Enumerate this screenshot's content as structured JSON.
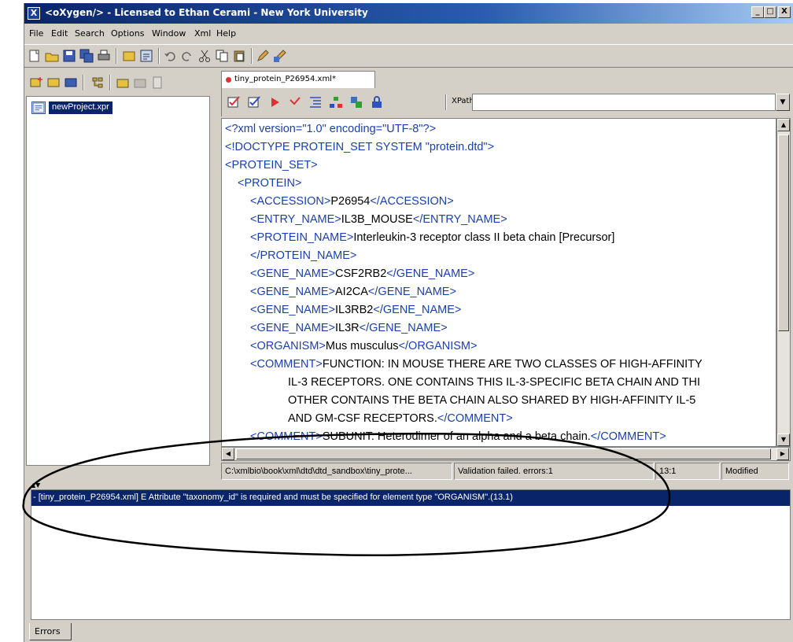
{
  "window": {
    "title": "<oXygen/> - Licensed to Ethan Cerami - New York University",
    "app_icon_glyph": "X",
    "controls": {
      "minimize": "_",
      "maximize": "□",
      "close": "X"
    }
  },
  "menu": [
    "File",
    "Edit",
    "Search",
    "Options",
    "Window",
    "Xml",
    "Help"
  ],
  "main_toolbar_icons": [
    "new-file-icon",
    "open-file-icon",
    "save-icon",
    "save-all-icon",
    "print-icon",
    "open-project-icon",
    "properties-icon",
    "undo-icon",
    "redo-icon",
    "cut-icon",
    "copy-icon",
    "paste-icon",
    "pencil-icon",
    "transform-icon"
  ],
  "project_toolbar_icons": [
    "new-project-icon",
    "open-project-icon",
    "save-project-icon",
    "tree-icon",
    "add-folder-icon",
    "add-files-icon",
    "add-file-icon"
  ],
  "project": {
    "item_label": "newProject.xpr"
  },
  "editor": {
    "tab_label": "tiny_protein_P26954.xml*",
    "toolbar_icons": [
      "validate-icon",
      "check-well-formed-icon",
      "run-icon",
      "transform-icon",
      "format-indent-icon",
      "tree-view-icon",
      "schema-icon",
      "lock-icon"
    ],
    "xpath_label": "XPath:",
    "xpath_value": "",
    "lines": [
      {
        "indent": 0,
        "parts": [
          [
            "tag",
            "<?xml version=\"1.0\" encoding=\"UTF-8\"?>"
          ]
        ]
      },
      {
        "indent": 0,
        "parts": [
          [
            "tag",
            "<!DOCTYPE PROTEIN_SET SYSTEM \"protein.dtd\">"
          ]
        ]
      },
      {
        "indent": 0,
        "parts": [
          [
            "tag",
            "<PROTEIN_SET>"
          ]
        ]
      },
      {
        "indent": 1,
        "parts": [
          [
            "tag",
            "<PROTEIN>"
          ]
        ]
      },
      {
        "indent": 2,
        "parts": [
          [
            "tag",
            "<ACCESSION>"
          ],
          [
            "txt",
            "P26954"
          ],
          [
            "tag",
            "</ACCESSION>"
          ]
        ]
      },
      {
        "indent": 2,
        "parts": [
          [
            "tag",
            "<ENTRY_NAME>"
          ],
          [
            "txt",
            "IL3B_MOUSE"
          ],
          [
            "tag",
            "</ENTRY_NAME>"
          ]
        ]
      },
      {
        "indent": 2,
        "parts": [
          [
            "tag",
            "<PROTEIN_NAME>"
          ],
          [
            "txt",
            "Interleukin-3 receptor class II beta chain [Precursor]"
          ]
        ]
      },
      {
        "indent": 2,
        "parts": [
          [
            "tag",
            "</PROTEIN_NAME>"
          ]
        ]
      },
      {
        "indent": 2,
        "parts": [
          [
            "tag",
            "<GENE_NAME>"
          ],
          [
            "txt",
            "CSF2RB2"
          ],
          [
            "tag",
            "</GENE_NAME>"
          ]
        ]
      },
      {
        "indent": 2,
        "parts": [
          [
            "tag",
            "<GENE_NAME>"
          ],
          [
            "txt",
            "AI2CA"
          ],
          [
            "tag",
            "</GENE_NAME>"
          ]
        ]
      },
      {
        "indent": 2,
        "parts": [
          [
            "tag",
            "<GENE_NAME>"
          ],
          [
            "txt",
            "IL3RB2"
          ],
          [
            "tag",
            "</GENE_NAME>"
          ]
        ]
      },
      {
        "indent": 2,
        "parts": [
          [
            "tag",
            "<GENE_NAME>"
          ],
          [
            "txt",
            "IL3R"
          ],
          [
            "tag",
            "</GENE_NAME>"
          ]
        ]
      },
      {
        "indent": 2,
        "parts": [
          [
            "tag",
            "<ORGANISM>"
          ],
          [
            "txt",
            "Mus musculus"
          ],
          [
            "tag",
            "</ORGANISM>"
          ]
        ]
      },
      {
        "indent": 2,
        "parts": [
          [
            "tag",
            "<COMMENT>"
          ],
          [
            "txt",
            "FUNCTION: IN MOUSE THERE ARE TWO CLASSES OF HIGH-AFFINITY"
          ]
        ]
      },
      {
        "indent": 5,
        "parts": [
          [
            "txt",
            "IL-3 RECEPTORS. ONE CONTAINS THIS IL-3-SPECIFIC BETA CHAIN AND THI"
          ]
        ]
      },
      {
        "indent": 5,
        "parts": [
          [
            "txt",
            "OTHER CONTAINS THE BETA CHAIN ALSO SHARED BY HIGH-AFFINITY IL-5"
          ]
        ]
      },
      {
        "indent": 5,
        "parts": [
          [
            "txt",
            "AND GM-CSF RECEPTORS."
          ],
          [
            "tag",
            "</COMMENT>"
          ]
        ]
      },
      {
        "indent": 2,
        "parts": [
          [
            "tag",
            "<COMMENT>"
          ],
          [
            "txt",
            "SUBUNIT: Heterodimer of an alpha and a beta chain."
          ],
          [
            "tag",
            "</COMMENT>"
          ]
        ]
      }
    ]
  },
  "status": {
    "path": "C:\\xmlbio\\book\\xml\\dtd\\dtd_sandbox\\tiny_prote...",
    "validation": "Validation failed. errors:1",
    "position": "13:1",
    "state": "Modified"
  },
  "errors": {
    "message": "- [tiny_protein_P26954.xml] E Attribute \"taxonomy_id\" is required and must be specified for element type \"ORGANISM\".(13.1)",
    "tab_label": "Errors"
  },
  "annotation": {
    "shape": "ellipse",
    "color": "#000000"
  }
}
